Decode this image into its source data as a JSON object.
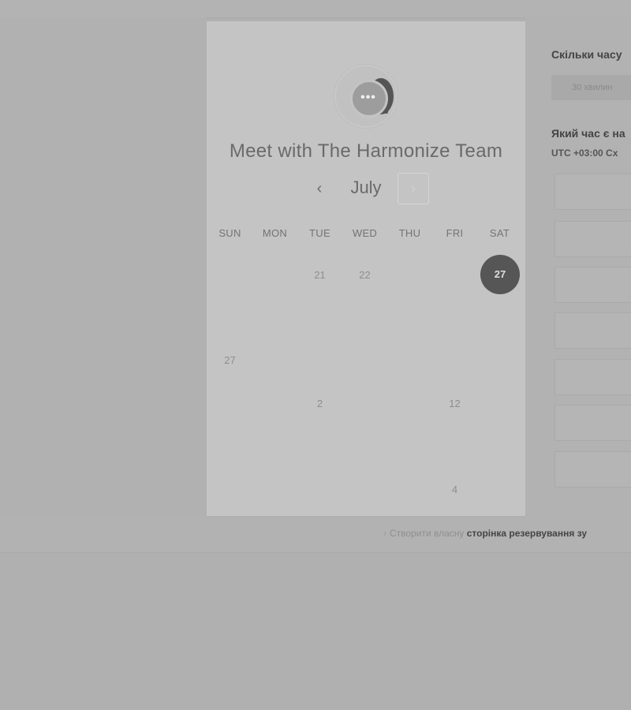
{
  "calendar": {
    "title": "Meet with The Harmonize Team",
    "month": "July",
    "prev_icon": "‹",
    "next_icon": "›",
    "weekdays": [
      "SUN",
      "MON",
      "TUE",
      "WED",
      "THU",
      "FRI",
      "SAT"
    ],
    "days": {
      "tue_21": "21",
      "wed_22": "22",
      "sat_27": "27",
      "sun_27": "27",
      "tue_2": "2",
      "fri_12": "12",
      "fri_4": "4"
    },
    "faint_marks": "·"
  },
  "logo": {
    "icon": "chat-bubbles-icon",
    "dots": "•••"
  },
  "booking": {
    "duration_question": "Скільки часу",
    "duration_option": "30 хвилин",
    "time_question": "Який час є на",
    "timezone": "UTC +03:00 Сх"
  },
  "footer": {
    "arrow": "›",
    "prefix": "Створити власну",
    "bold": "сторінка резервування зу"
  },
  "colors": {
    "background": "#b0b0b0",
    "card": "#c4c4c4",
    "selected_day": "#565656"
  }
}
